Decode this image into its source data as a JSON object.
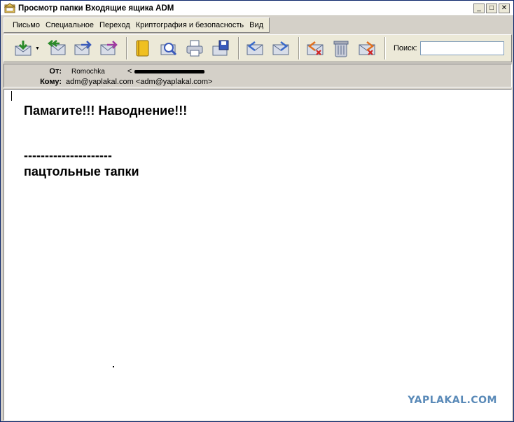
{
  "window": {
    "title": "Просмотр папки Входящие ящика ADM",
    "controls": [
      "_",
      "□",
      "✕"
    ]
  },
  "menu": [
    {
      "label": "Письмо",
      "underline": "П"
    },
    {
      "label": "Специальное",
      "underline": "С"
    },
    {
      "label": "Переход",
      "underline": "П"
    },
    {
      "label": "Криптография и безопасность",
      "underline": "К"
    },
    {
      "label": "Вид",
      "underline": "В"
    }
  ],
  "toolbar": {
    "search_label": "Поиск:",
    "search_value": ""
  },
  "header": {
    "from_label": "От:",
    "from_name": "Romochka",
    "from_addr_prefix": "<",
    "to_label": "Кому:",
    "to_value": "adm@yaplakal.com <adm@yaplakal.com>"
  },
  "message": {
    "line1": "Памагите!!! Наводнение!!!",
    "line2": "---------------------",
    "line3": "пацтольные тапки"
  },
  "watermark": "YAPLAKAL.COM"
}
